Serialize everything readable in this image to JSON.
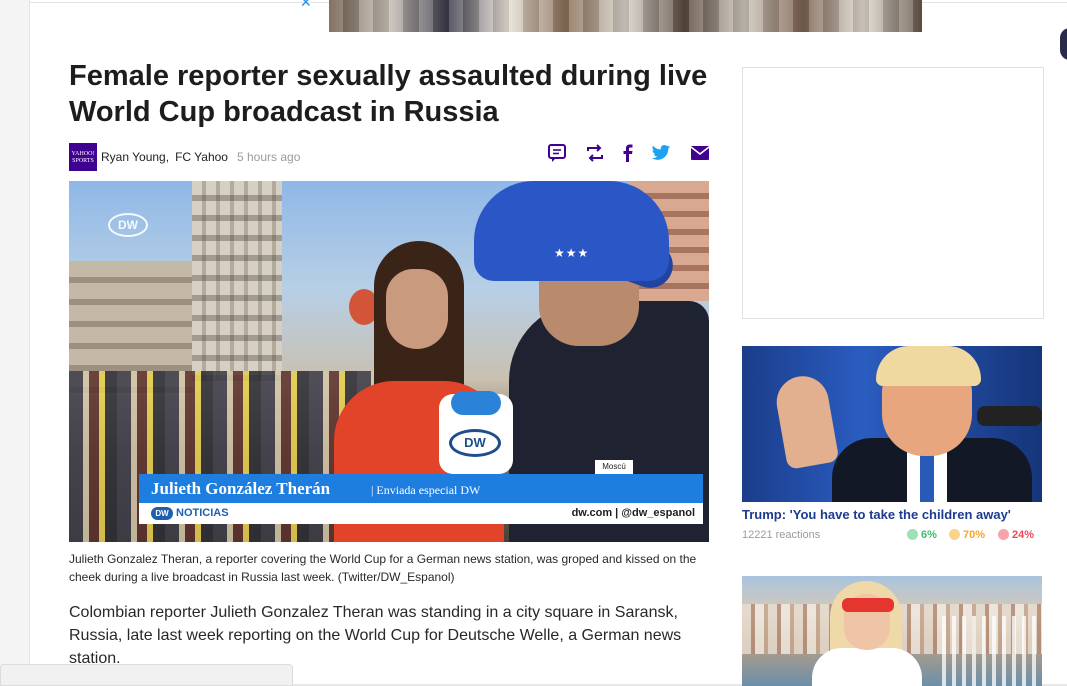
{
  "article": {
    "headline": "Female reporter sexually assaulted during live World Cup broadcast in Russia",
    "logo_text": "YAHOO! SPORTS",
    "author": "Ryan Young,",
    "provider": "FC Yahoo",
    "time": "5 hours ago",
    "share_icons": [
      "comment-icon",
      "retweet-icon",
      "facebook-icon",
      "twitter-icon",
      "mail-icon"
    ],
    "hero": {
      "lower_third_name": "Julieth González Therán",
      "lower_third_sub": "| Enviada especial DW",
      "location": "Moscú",
      "network": "NOTICIAS",
      "network_logo": "DW",
      "credits": "dw.com  |  @dw_espanol",
      "corner_logo": "DW",
      "mic_logo": "DW"
    },
    "caption": "Julieth Gonzalez Theran, a reporter covering the World Cup for a German news station, was groped and kissed on the cheek during a live broadcast in Russia last week. (Twitter/DW_Espanol)",
    "body": "Colombian reporter Julieth Gonzalez Theran was standing in a city square in Saransk, Russia, late last week reporting on the World Cup for Deutsche Welle, a German news station."
  },
  "sidebar": {
    "story1": {
      "title": "Trump: 'You have to take the children away'",
      "reactions": "12221 reactions",
      "positive": "6%",
      "neutral": "70%",
      "negative": "24%"
    }
  },
  "colors": {
    "accent": "#400090",
    "headline": "#1d1d1d",
    "link": "#1d3c8f",
    "share_purple": "#400090",
    "facebook": "#3b5998",
    "twitter": "#1da1f2",
    "positive": "#3cbd6e",
    "neutral": "#f6a623",
    "negative": "#f0465a"
  }
}
